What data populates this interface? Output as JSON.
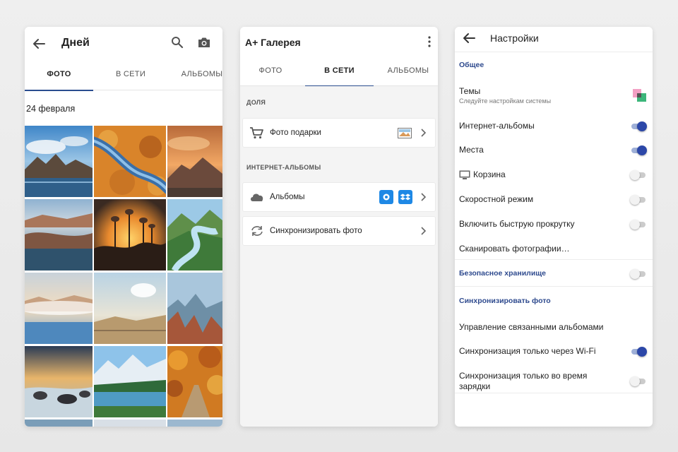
{
  "gallery": {
    "title": "Дней",
    "tabs": [
      "ФОТО",
      "В СЕТИ",
      "АЛЬБОМЫ"
    ],
    "active_tab": 0,
    "date_label": "24 февраля"
  },
  "online": {
    "title": "A+ Галерея",
    "tabs": [
      "ФОТО",
      "В СЕТИ",
      "АЛЬБОМЫ"
    ],
    "active_tab": 1,
    "section_share": "ДОЛЯ",
    "gifts_label": "Фото подарки",
    "section_albums": "ИНТЕРНЕТ-АЛЬБОМЫ",
    "albums_label": "Альбомы",
    "sync_label": "Синхронизировать фото"
  },
  "settings": {
    "title": "Настройки",
    "general_header": "Общее",
    "themes_label": "Темы",
    "themes_sub": "Следуйте настройкам системы",
    "internet_albums": "Интернет-альбомы",
    "places": "Места",
    "trash": "Корзина",
    "speed_mode": "Скоростной режим",
    "fast_scroll": "Включить быструю прокрутку",
    "scan_photos": "Сканировать фотографии…",
    "secure_storage": "Безопасное хранилище",
    "sync_header": "Синхронизировать фото",
    "manage_albums": "Управление связанными альбомами",
    "wifi_only": "Синхронизация только через Wi-Fi",
    "charging_only_line1": "Синхронизация только во время",
    "charging_only_line2": "зарядки",
    "toggles": {
      "internet_albums": true,
      "places": true,
      "trash": false,
      "speed_mode": false,
      "fast_scroll": false,
      "secure_storage": false,
      "wifi_only": true,
      "charging_only": false
    }
  },
  "colors": {
    "accent": "#2c47a8",
    "header_blue": "#2e4a8e",
    "tab_indicator": "#2a4d8f",
    "dropbox_blue": "#1e88e5"
  }
}
